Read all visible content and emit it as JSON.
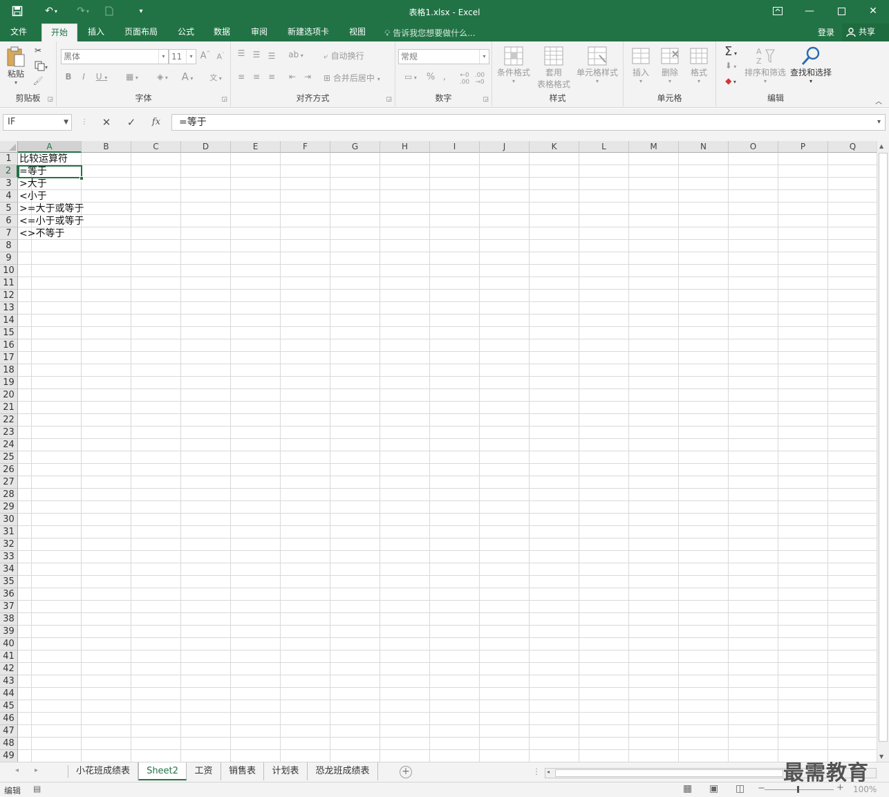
{
  "titlebar": {
    "title": "表格1.xlsx - Excel",
    "more_label": "▾"
  },
  "ribbon_tabs": [
    "文件",
    "开始",
    "插入",
    "页面布局",
    "公式",
    "数据",
    "审阅",
    "新建选项卡",
    "视图"
  ],
  "active_tab": "开始",
  "tell_me": "告诉我您想要做什么...",
  "login_label": "登录",
  "share_label": "共享",
  "groups": {
    "clipboard": {
      "label": "剪贴板",
      "paste": "粘贴"
    },
    "font": {
      "label": "字体",
      "font_name": "黑体",
      "font_size": "11"
    },
    "alignment": {
      "label": "对齐方式",
      "wrap": "自动换行",
      "merge": "合并后居中"
    },
    "number": {
      "label": "数字",
      "format": "常规"
    },
    "styles": {
      "label": "样式",
      "conditional": "条件格式",
      "table_line1": "套用",
      "table_line2": "表格格式",
      "cell_styles": "单元格样式"
    },
    "cells": {
      "label": "单元格",
      "insert": "插入",
      "delete": "删除",
      "format": "格式"
    },
    "editing": {
      "label": "编辑",
      "sort": "排序和筛选",
      "find": "查找和选择"
    }
  },
  "formula_bar": {
    "name_box": "IF",
    "formula": "=等于"
  },
  "columns": [
    "A",
    "B",
    "C",
    "D",
    "E",
    "F",
    "G",
    "H",
    "I",
    "J",
    "K",
    "L",
    "M",
    "N",
    "O",
    "P",
    "Q"
  ],
  "selected_column": "A",
  "selected_row": 2,
  "cells": [
    {
      "row": 1,
      "text": "比较运算符"
    },
    {
      "row": 2,
      "text": "=等于"
    },
    {
      "row": 3,
      "text": ">大于"
    },
    {
      "row": 4,
      "text": "<小于"
    },
    {
      "row": 5,
      "text": ">=大于或等于"
    },
    {
      "row": 6,
      "text": "<=小于或等于"
    },
    {
      "row": 7,
      "text": "<>不等于"
    }
  ],
  "row_count": 49,
  "sheets": [
    "小花班成绩表",
    "Sheet2",
    "工资",
    "销售表",
    "计划表",
    "恐龙班成绩表"
  ],
  "active_sheet": "Sheet2",
  "status": {
    "mode": "编辑",
    "zoom": "100%"
  },
  "watermark": "最需教育",
  "colors": {
    "accent": "#217346"
  }
}
